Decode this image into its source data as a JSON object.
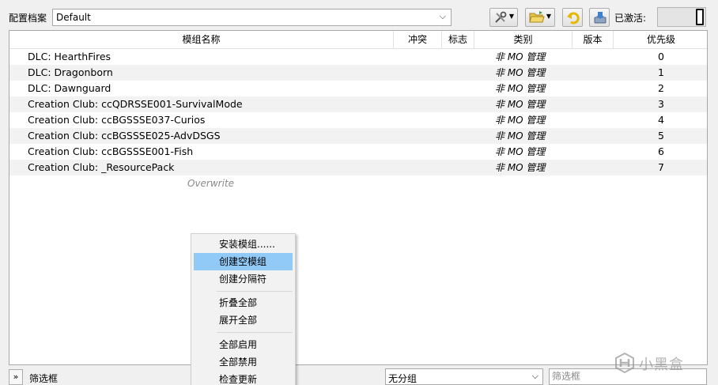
{
  "toolbar": {
    "profile_label": "配置档案",
    "profile_value": "Default",
    "active_label": "已激活:",
    "icons": [
      "tools-icon",
      "folder-icon",
      "undo-icon",
      "download-icon"
    ]
  },
  "columns": {
    "name": "模组名称",
    "conflicts": "冲突",
    "flags": "标志",
    "category": "类别",
    "version": "版本",
    "priority": "优先级"
  },
  "mods": [
    {
      "name": "DLC: HearthFires",
      "category": "非 MO 管理",
      "priority": "0"
    },
    {
      "name": "DLC: Dragonborn",
      "category": "非 MO 管理",
      "priority": "1"
    },
    {
      "name": "DLC: Dawnguard",
      "category": "非 MO 管理",
      "priority": "2"
    },
    {
      "name": "Creation Club: ccQDRSSE001-SurvivalMode",
      "category": "非 MO 管理",
      "priority": "3"
    },
    {
      "name": "Creation Club: ccBGSSSE037-Curios",
      "category": "非 MO 管理",
      "priority": "4"
    },
    {
      "name": "Creation Club: ccBGSSSE025-AdvDSGS",
      "category": "非 MO 管理",
      "priority": "5"
    },
    {
      "name": "Creation Club: ccBGSSSE001-Fish",
      "category": "非 MO 管理",
      "priority": "6"
    },
    {
      "name": "Creation Club: _ResourcePack",
      "category": "非 MO 管理",
      "priority": "7"
    }
  ],
  "overwrite_label": "Overwrite",
  "context_menu": {
    "install_mod": "安装模组......",
    "create_empty_mod": "创建空模组",
    "create_separator": "创建分隔符",
    "collapse_all": "折叠全部",
    "expand_all": "展开全部",
    "enable_all": "全部启用",
    "disable_all": "全部禁用",
    "check_updates": "检查更新"
  },
  "bottom": {
    "expand_symbol": "»",
    "filter_label": "筛选框",
    "group_value": "无分组",
    "filter_placeholder": "筛选框"
  },
  "watermark": {
    "text": "小黑盒"
  }
}
